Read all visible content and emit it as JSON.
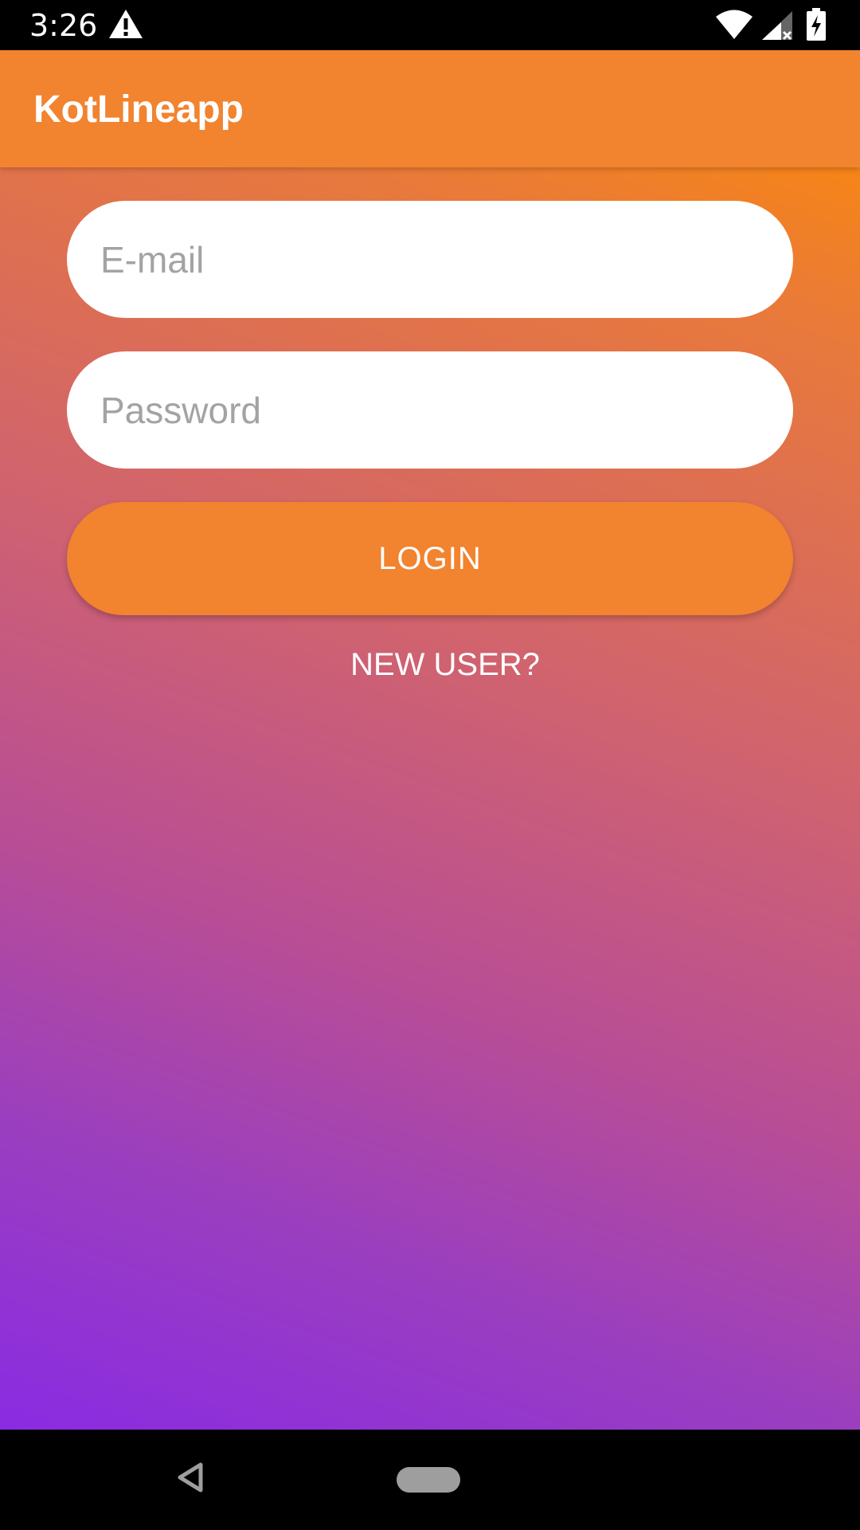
{
  "status_bar": {
    "time": "3:26",
    "icons": [
      "warning-icon",
      "wifi-icon",
      "signal-icon",
      "battery-charging-icon"
    ]
  },
  "toolbar": {
    "title": "KotLineapp"
  },
  "login_form": {
    "email_placeholder": "E-mail",
    "email_value": "",
    "password_placeholder": "Password",
    "password_value": "",
    "login_label": "LOGIN",
    "new_user_label": "NEW USER?"
  },
  "nav_bar": {
    "icons": [
      "back-icon",
      "home-pill-icon"
    ]
  },
  "colors": {
    "accent": "#f2832f",
    "gradient_top": "#ff8c00",
    "gradient_bottom": "#8a2be2",
    "placeholder": "#a3a3a3"
  }
}
